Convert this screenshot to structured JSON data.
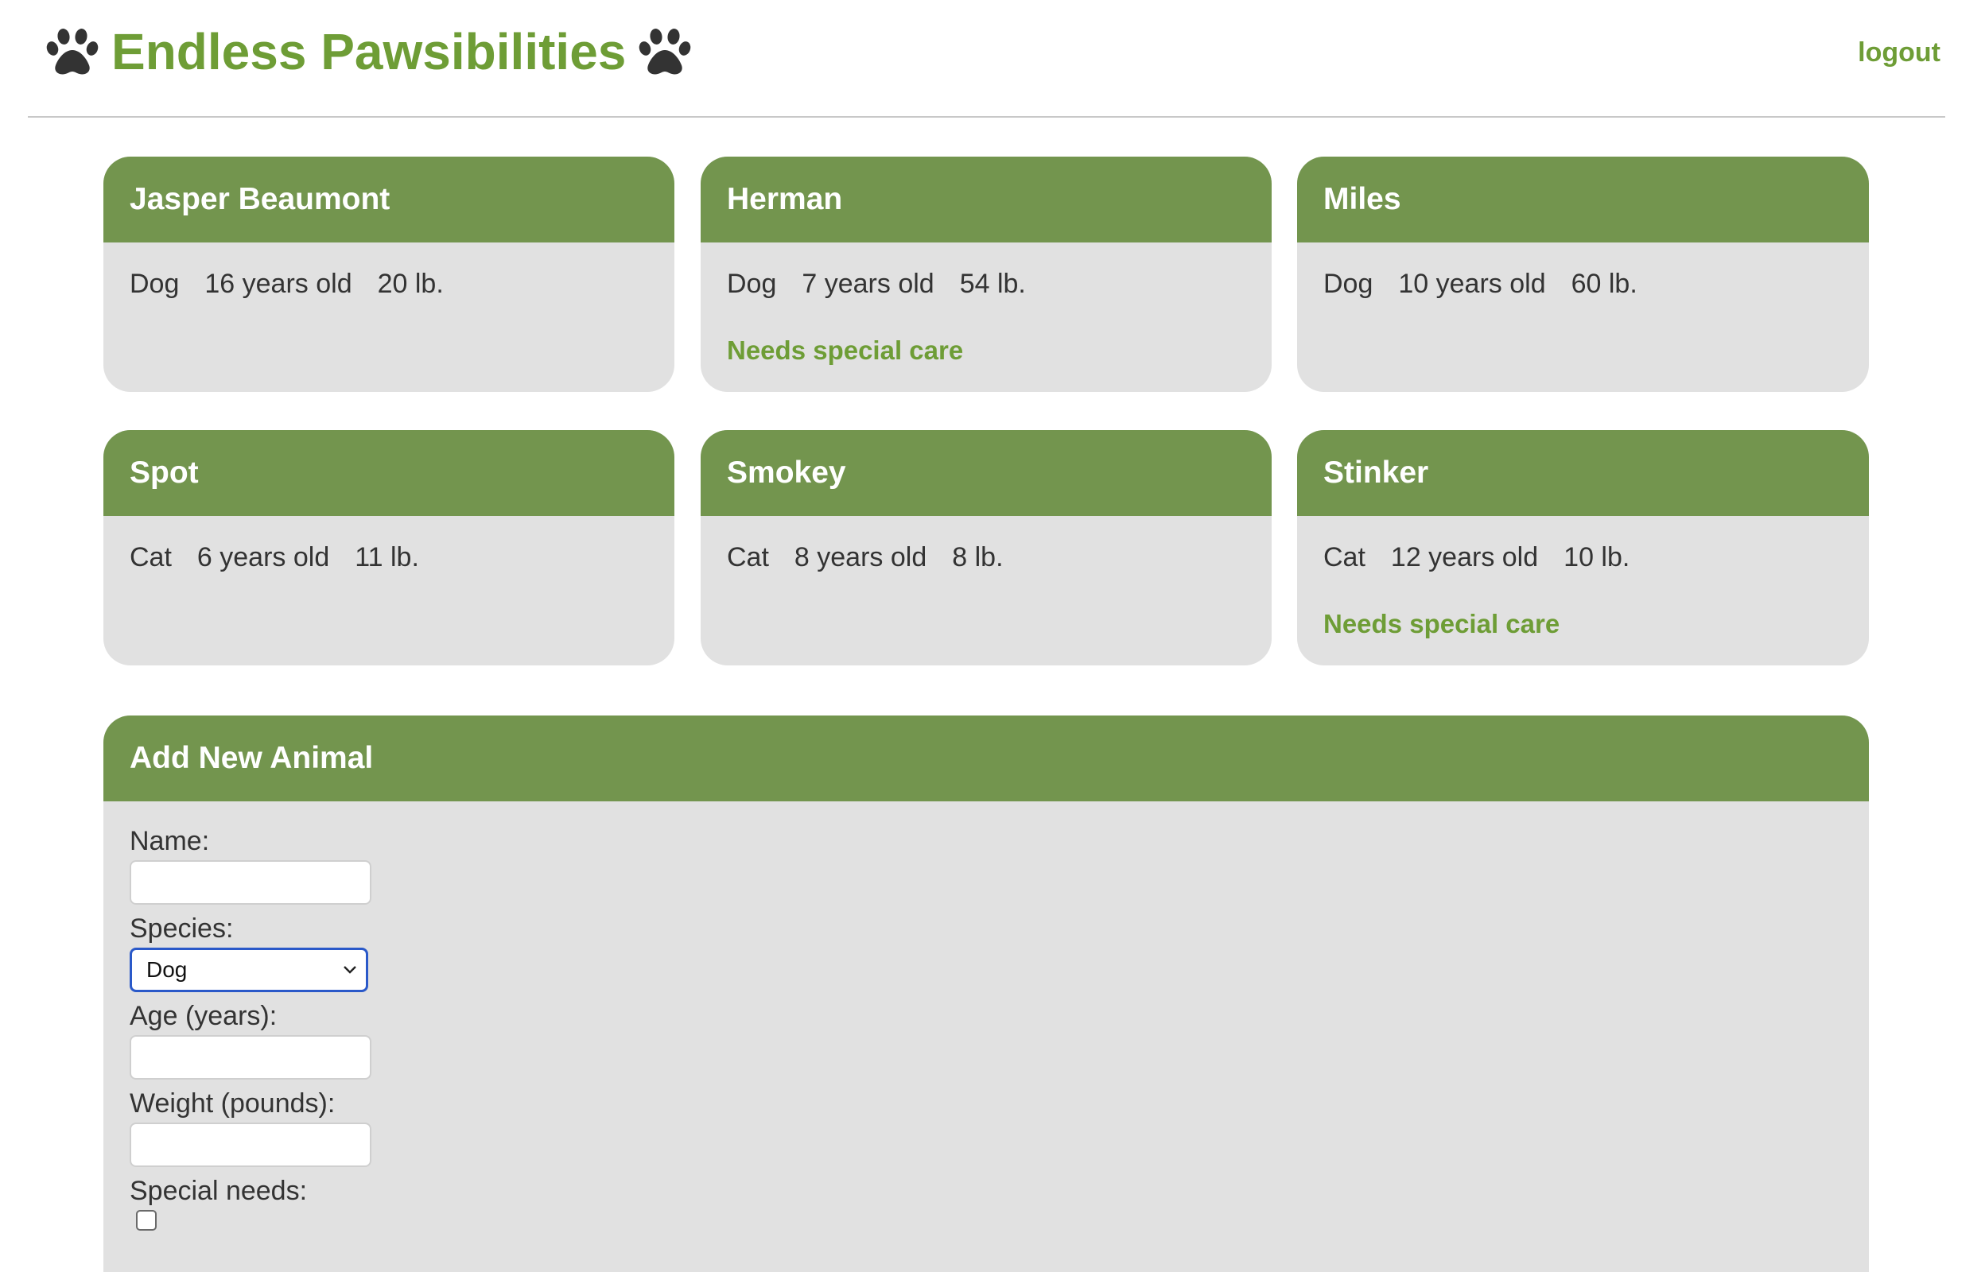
{
  "header": {
    "title": "Endless Pawsibilities",
    "logout_label": "logout",
    "paw_icon": "paw-icon",
    "accent_color": "#6e9d36"
  },
  "animals": [
    {
      "name": "Jasper Beaumont",
      "species": "Dog",
      "age": "16 years old",
      "weight": "20 lb.",
      "special_care": ""
    },
    {
      "name": "Herman",
      "species": "Dog",
      "age": "7 years old",
      "weight": "54 lb.",
      "special_care": "Needs special care"
    },
    {
      "name": "Miles",
      "species": "Dog",
      "age": "10 years old",
      "weight": "60 lb.",
      "special_care": ""
    },
    {
      "name": "Spot",
      "species": "Cat",
      "age": "6 years old",
      "weight": "11 lb.",
      "special_care": ""
    },
    {
      "name": "Smokey",
      "species": "Cat",
      "age": "8 years old",
      "weight": "8 lb.",
      "special_care": ""
    },
    {
      "name": "Stinker",
      "species": "Cat",
      "age": "12 years old",
      "weight": "10 lb.",
      "special_care": "Needs special care"
    }
  ],
  "form": {
    "title": "Add New Animal",
    "name_label": "Name:",
    "name_value": "",
    "species_label": "Species:",
    "species_value": "Dog",
    "age_label": "Age (years):",
    "age_value": "",
    "weight_label": "Weight (pounds):",
    "weight_value": "",
    "special_label": "Special needs:",
    "special_checked": false
  }
}
